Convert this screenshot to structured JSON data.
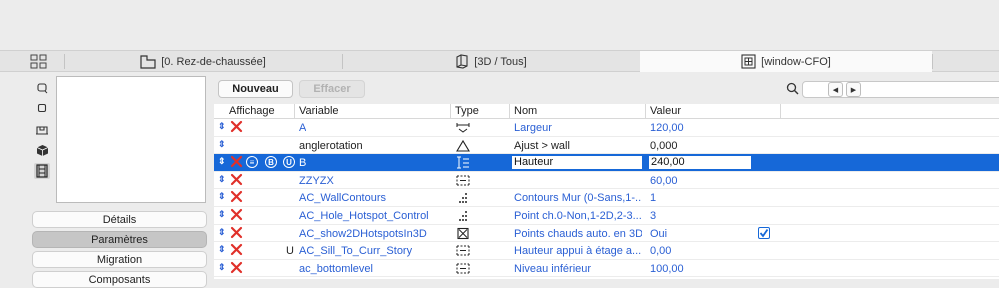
{
  "tabs": [
    {
      "label": "[0. Rez-de-chaussée]",
      "icon": "floorplan-icon",
      "active": false
    },
    {
      "label": "[3D / Tous]",
      "icon": "3d-box-icon",
      "active": false
    },
    {
      "label": "[window-CFO]",
      "icon": "window-object-icon",
      "active": true
    }
  ],
  "sidebar": {
    "icons": [
      "rotate-left-icon",
      "square-icon",
      "elevation-icon",
      "cube-icon",
      "film-icon"
    ],
    "buttons": [
      {
        "label": "Détails",
        "active": false
      },
      {
        "label": "Paramètres",
        "active": true
      },
      {
        "label": "Migration",
        "active": false
      },
      {
        "label": "Composants",
        "active": false
      }
    ]
  },
  "toolbar": {
    "new_label": "Nouveau",
    "delete_label": "Effacer",
    "search_value": ""
  },
  "table": {
    "headers": {
      "display": "Affichage",
      "variable": "Variable",
      "type": "Type",
      "name": "Nom",
      "value": "Valeur"
    },
    "rows": [
      {
        "variable": "A",
        "name": "Largeur",
        "value": "120,00",
        "type_icon": "width-dimension-icon",
        "color": "blue",
        "has_x": true
      },
      {
        "variable": "anglerotation",
        "name": "Ajust > wall",
        "value": "0,000",
        "type_icon": "angle-icon",
        "color": "dark",
        "has_x": false
      },
      {
        "variable": "B",
        "name": "Hauteur",
        "value": "240,00",
        "type_icon": "height-dimension-icon",
        "color": "white",
        "has_x": true,
        "selected": true
      },
      {
        "variable": "ZZYZX",
        "name": "",
        "value": "60,00",
        "type_icon": "length-dimension-icon",
        "color": "blue",
        "has_x": true
      },
      {
        "variable": "AC_WallContours",
        "name": "Contours Mur (0-Sans,1-...",
        "value": "1",
        "type_icon": "integer-icon",
        "color": "blue",
        "has_x": true
      },
      {
        "variable": "AC_Hole_Hotspot_Control",
        "name": "Point ch.0-Non,1-2D,2-3...",
        "value": "3",
        "type_icon": "integer-icon",
        "color": "blue",
        "has_x": true
      },
      {
        "variable": "AC_show2DHotspotsIn3D",
        "name": "Points chauds auto. en 3D",
        "value": "Oui",
        "type_icon": "boolean-icon",
        "color": "blue",
        "has_x": true,
        "checked": true
      },
      {
        "variable": "AC_Sill_To_Curr_Story",
        "name": "Hauteur appui à étage a...",
        "value": "0,00",
        "type_icon": "length-dimension-icon",
        "color": "blue",
        "has_x": true,
        "flag": "U"
      },
      {
        "variable": "ac_bottomlevel",
        "name": "Niveau inférieur",
        "value": "100,00",
        "type_icon": "length-dimension-icon",
        "color": "blue",
        "has_x": true
      }
    ],
    "selected_badges": [
      "B",
      "U"
    ]
  },
  "colors": {
    "accent": "#1668d8",
    "link": "#2a5fd4",
    "delete": "#e0302a"
  }
}
